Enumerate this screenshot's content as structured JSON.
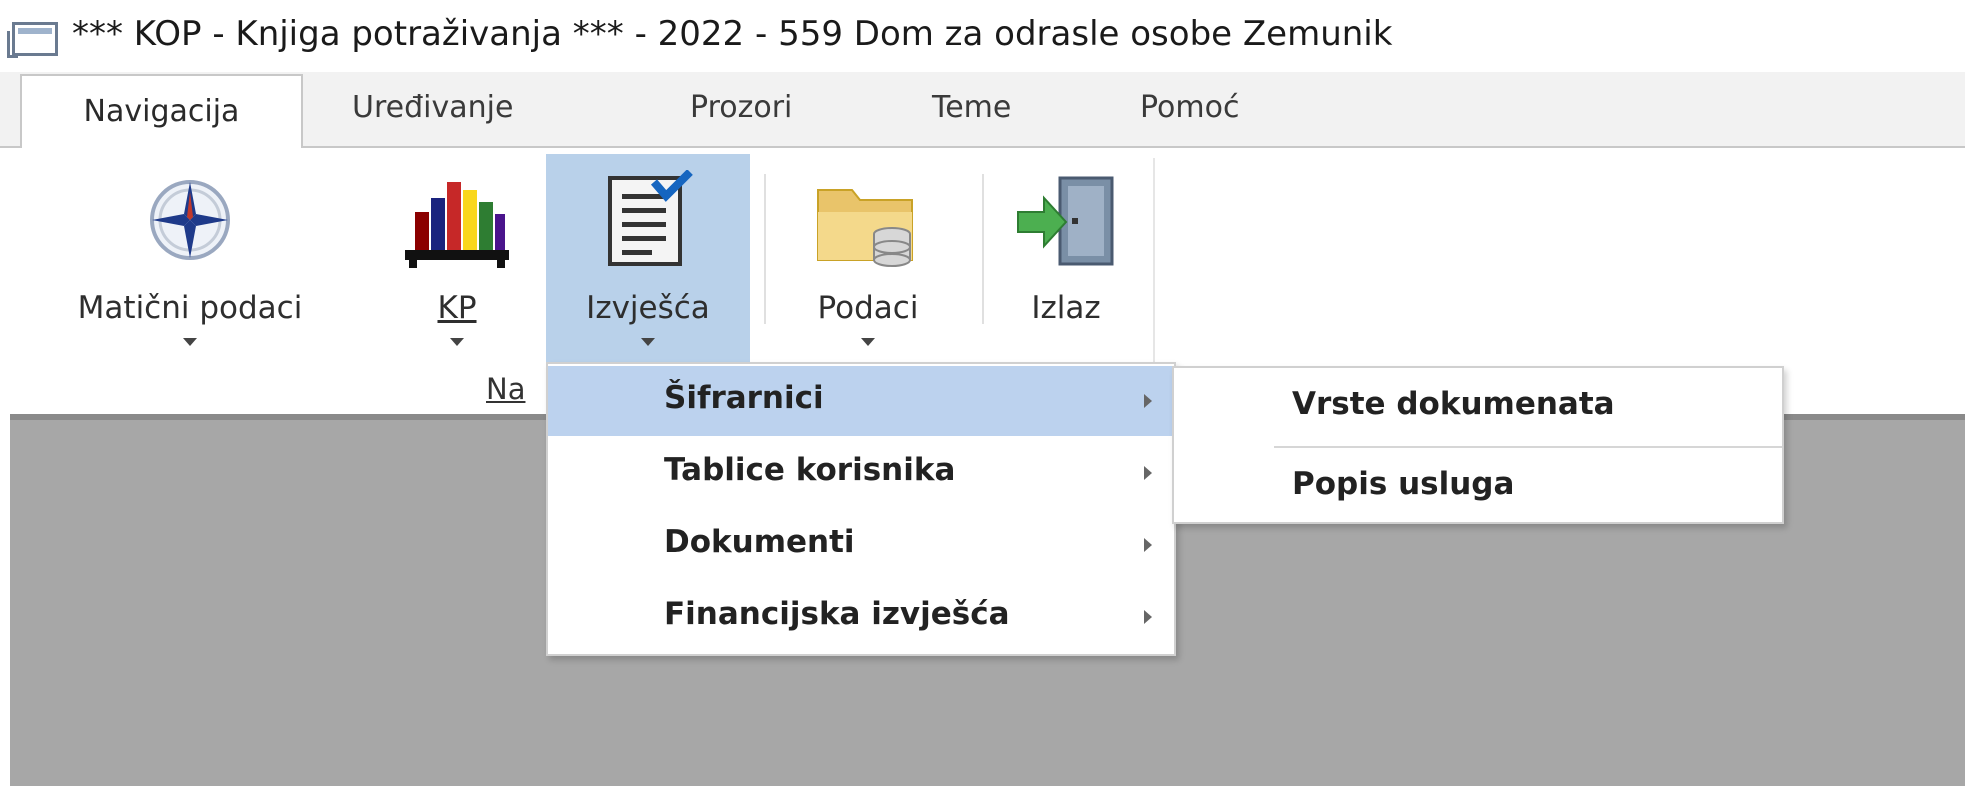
{
  "window": {
    "title": "*** KOP - Knjiga potraživanja *** - 2022 - 559 Dom za odrasle osobe Zemunik",
    "icon": "window-icon"
  },
  "tabs": [
    {
      "label": "Navigacija",
      "active": true
    },
    {
      "label": "Uređivanje",
      "active": false
    },
    {
      "label": "Prozori",
      "active": false
    },
    {
      "label": "Teme",
      "active": false
    },
    {
      "label": "Pomoć",
      "active": false
    }
  ],
  "ribbon": {
    "buttons": [
      {
        "label": "Matični podaci",
        "icon": "compass-icon",
        "has_dropdown": true
      },
      {
        "label": "KP",
        "icon": "books-icon",
        "has_dropdown": true
      },
      {
        "label": "Izvješća",
        "icon": "report-checklist-icon",
        "has_dropdown": true,
        "selected": true
      },
      {
        "label": "Podaci",
        "icon": "folder-database-icon",
        "has_dropdown": true
      },
      {
        "label": "Izlaz",
        "icon": "exit-door-icon",
        "has_dropdown": false
      }
    ],
    "group_label": "Na"
  },
  "dropdown": {
    "items": [
      {
        "label": "Šifrarnici",
        "has_submenu": true,
        "highlighted": true
      },
      {
        "label": "Tablice korisnika",
        "has_submenu": true,
        "highlighted": false
      },
      {
        "label": "Dokumenti",
        "has_submenu": true,
        "highlighted": false
      },
      {
        "label": "Financijska izvješća",
        "has_submenu": true,
        "highlighted": false
      }
    ]
  },
  "submenu": {
    "items": [
      {
        "label": "Vrste dokumenata"
      },
      {
        "label": "Popis usluga"
      }
    ]
  },
  "colors": {
    "selection": "#b9d1ea",
    "menu_highlight": "#bcd2ee",
    "workspace": "#a7a7a7",
    "tab_strip": "#f2f2f2"
  }
}
